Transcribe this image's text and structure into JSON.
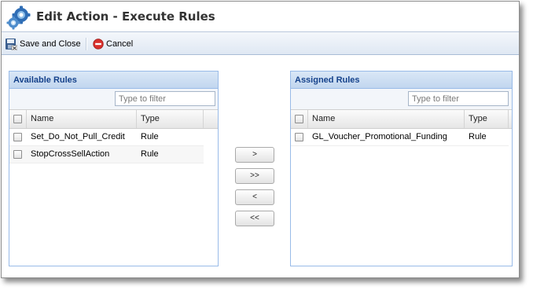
{
  "window": {
    "title": "Edit Action - Execute Rules"
  },
  "toolbar": {
    "save_label": "Save and Close",
    "cancel_label": "Cancel"
  },
  "available": {
    "title": "Available Rules",
    "filter_placeholder": "Type to filter",
    "columns": {
      "name": "Name",
      "type": "Type"
    },
    "rows": [
      {
        "name": "Set_Do_Not_Pull_Credit",
        "type": "Rule"
      },
      {
        "name": "StopCrossSellAction",
        "type": "Rule"
      }
    ]
  },
  "assigned": {
    "title": "Assigned Rules",
    "filter_placeholder": "Type to filter",
    "columns": {
      "name": "Name",
      "type": "Type"
    },
    "rows": [
      {
        "name": "GL_Voucher_Promotional_Funding",
        "type": "Rule"
      }
    ]
  },
  "transfer": {
    "add_one": ">",
    "add_all": ">>",
    "remove_one": "<",
    "remove_all": "<<"
  },
  "colors": {
    "panel_header_text": "#15428b",
    "panel_border": "#99bbe8",
    "cancel_icon": "#d9302c"
  },
  "icons": {
    "title": "gears-icon",
    "save": "save-disk-icon",
    "cancel": "cancel-circle-icon"
  }
}
